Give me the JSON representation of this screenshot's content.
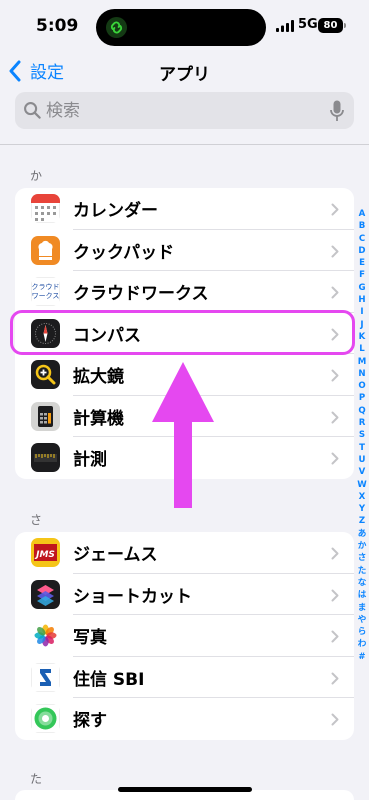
{
  "status": {
    "time": "5:09",
    "network": "5G",
    "battery": "80"
  },
  "nav": {
    "back_label": "設定",
    "title": "アプリ"
  },
  "search": {
    "placeholder": "検索"
  },
  "sections": [
    {
      "header": "か",
      "items": [
        {
          "label": "カレンダー",
          "icon": "calendar-icon"
        },
        {
          "label": "クックパッド",
          "icon": "cookpad-icon"
        },
        {
          "label": "クラウドワークス",
          "icon": "crowdworks-icon",
          "icon_text": "クラウド\nワークス"
        },
        {
          "label": "コンパス",
          "icon": "compass-icon"
        },
        {
          "label": "拡大鏡",
          "icon": "magnifier-icon"
        },
        {
          "label": "計算機",
          "icon": "calculator-icon"
        },
        {
          "label": "計測",
          "icon": "measure-icon"
        }
      ]
    },
    {
      "header": "さ",
      "items": [
        {
          "label": "ジェームス",
          "icon": "james-icon",
          "icon_text": "JMS"
        },
        {
          "label": "ショートカット",
          "icon": "shortcuts-icon"
        },
        {
          "label": "写真",
          "icon": "photos-icon"
        },
        {
          "label": "住信 SBI",
          "icon": "sbi-icon"
        },
        {
          "label": "探す",
          "icon": "findmy-icon"
        }
      ]
    },
    {
      "header": "た",
      "items": []
    }
  ],
  "index_letters": [
    "A",
    "B",
    "C",
    "D",
    "E",
    "F",
    "G",
    "H",
    "I",
    "J",
    "K",
    "L",
    "M",
    "N",
    "O",
    "P",
    "Q",
    "R",
    "S",
    "T",
    "U",
    "V",
    "W",
    "X",
    "Y",
    "Z",
    "あ",
    "か",
    "さ",
    "た",
    "な",
    "は",
    "ま",
    "や",
    "ら",
    "わ",
    "#"
  ],
  "colors": {
    "accent": "#0a84ff",
    "highlight": "#e548f0"
  }
}
